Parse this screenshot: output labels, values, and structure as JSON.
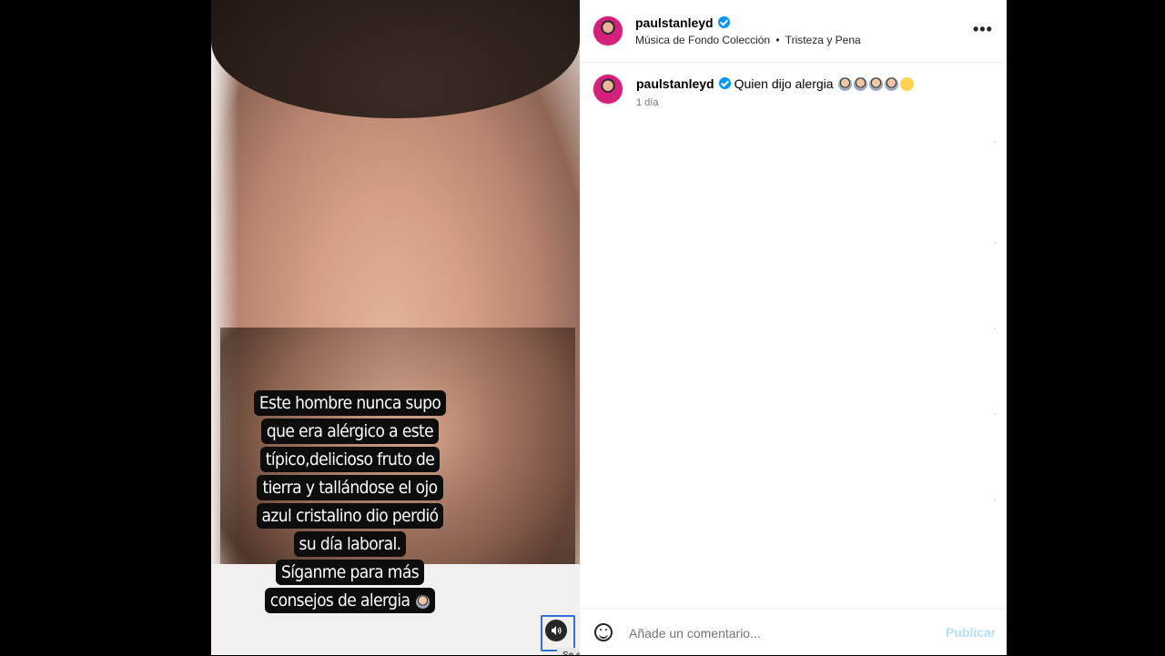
{
  "post": {
    "caption_overlay": [
      "Este hombre nunca supo",
      "que era alérgico a este",
      "típico,delicioso fruto de",
      "tierra y tallándose el ojo",
      "azul cristalino dio perdió",
      "su día laboral.",
      "Síganme para más",
      "consejos de alergia"
    ],
    "audio_tooltip": "Se está reproduciendo audio"
  },
  "header": {
    "username": "paulstanleyd",
    "audio": "Música de Fondo Colección",
    "separator": "•",
    "track": "Tristeza y Pena",
    "more_icon": "more-horizontal-icon"
  },
  "comment": {
    "username": "paulstanleyd",
    "text": "Quien dijo alergia",
    "time": "1 día"
  },
  "footer": {
    "placeholder": "Añade un comentario...",
    "publish_label": "Publicar"
  },
  "colors": {
    "verified": "#0095f6",
    "publish_disabled": "#b2dffc",
    "focus_ring": "#2f6fde"
  }
}
